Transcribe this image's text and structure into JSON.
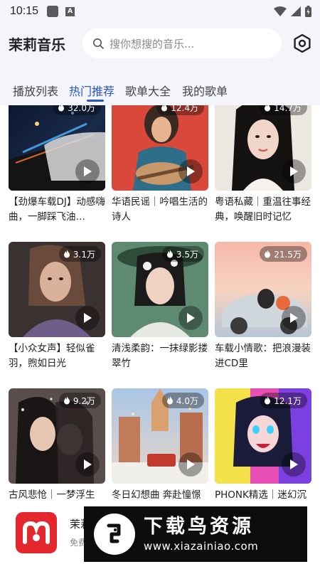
{
  "status_bar": {
    "time": "10:15",
    "notification_letter": "A"
  },
  "header": {
    "title": "茉莉音乐",
    "search_placeholder": "搜你想搜的音乐...",
    "settings_icon": "settings-hex-icon"
  },
  "tabs": [
    {
      "label": "播放列表",
      "active": false
    },
    {
      "label": "热门推荐",
      "active": true
    },
    {
      "label": "歌单大全",
      "active": false
    },
    {
      "label": "我的歌单",
      "active": false
    }
  ],
  "playlists": [
    {
      "title": "【劲爆车载DJ】动感嗨曲，一脚踩飞油…",
      "plays": "32.0万"
    },
    {
      "title": "华语民谣｜吟唱生活的诗人",
      "plays": "12.4万"
    },
    {
      "title": "粤语私藏｜重温往事经典，唤醒旧时记忆",
      "plays": "14.7万"
    },
    {
      "title": "【小众女声】轻似雀羽，煦如日光",
      "plays": "3.1万"
    },
    {
      "title": "清浅柔韵：一抹绿影搂翠竹",
      "plays": "3.5万"
    },
    {
      "title": "车载小情歌：把浪漫装进CD里",
      "plays": "21.5万"
    },
    {
      "title": "古风悲怆｜一梦浮生",
      "plays": "9.2万"
    },
    {
      "title": "冬日幻想曲 奔赴憧憬",
      "plays": "4.0万"
    },
    {
      "title": "PHONK精选｜迷幻沉沦",
      "plays": "12.1万"
    }
  ],
  "mini_player": {
    "name": "茉莉",
    "subtitle": "免费"
  },
  "watermark": {
    "title": "下载鸟资源",
    "url": "www.xiazainiao.com"
  },
  "colors": {
    "accent": "#2b53c4",
    "header_bg": "#f4f5fb",
    "logo_red": "#e3272d"
  }
}
